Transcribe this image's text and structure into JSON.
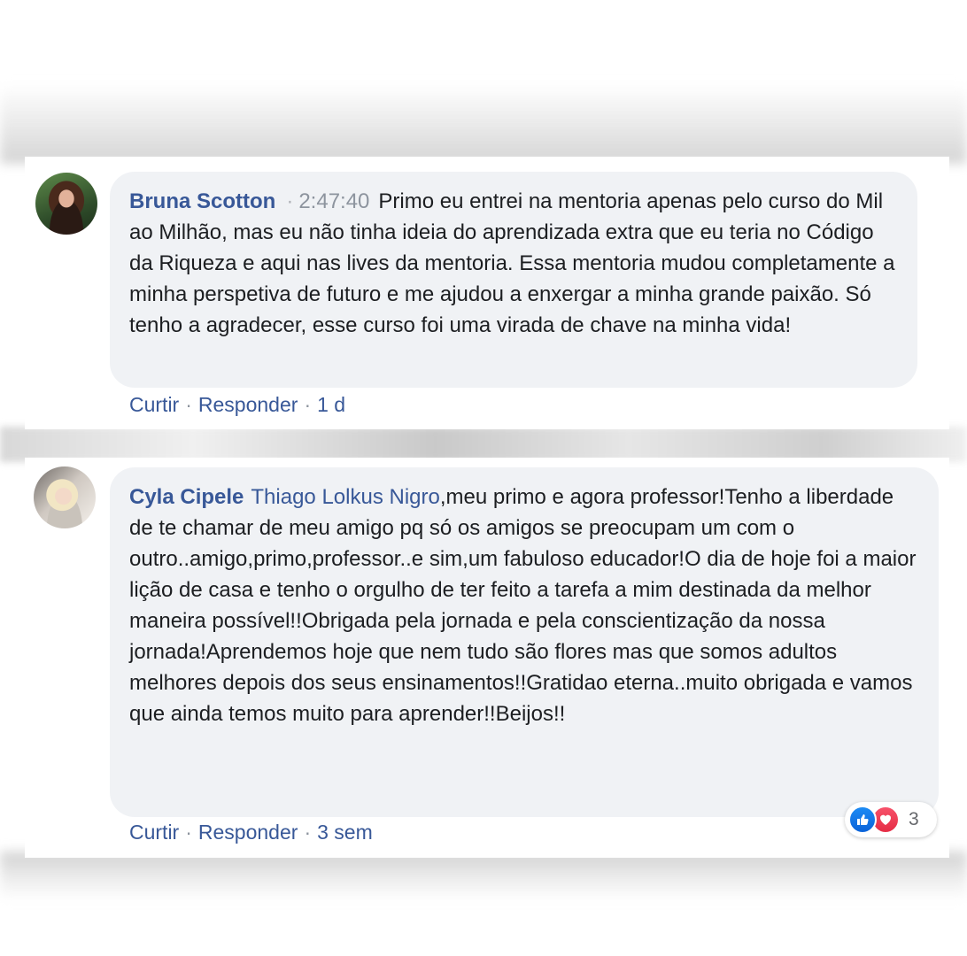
{
  "comments": [
    {
      "author": "Bruna Scotton",
      "separator": "·",
      "timestamp": "2:47:40",
      "text": "Primo eu entrei na mentoria apenas pelo curso do Mil ao Milhão, mas eu não tinha ideia do aprendizada extra que eu teria no Código da Riqueza e aqui nas lives da mentoria. Essa mentoria mudou completamente a minha perspetiva de futuro e me ajudou a enxergar a minha grande paixão. Só tenho a agradecer, esse curso foi uma virada de chave na minha vida!",
      "actions": {
        "like": "Curtir",
        "reply": "Responder",
        "dot": "·",
        "age": "1 d"
      }
    },
    {
      "author": "Cyla Cipele",
      "mention": "Thiago Lolkus Nigro",
      "text": ",meu primo e agora professor!Tenho a liberdade de te chamar de meu amigo pq só os amigos se preocupam um com o outro..amigo,primo,professor..e sim,um fabuloso educador!O dia de hoje foi a maior lição de casa e tenho o orgulho de ter feito a tarefa a mim destinada da melhor maneira possível!!Obrigada pela jornada e pela conscientização da nossa jornada!Aprendemos hoje que nem tudo são flores mas que somos adultos melhores depois dos seus ensinamentos!!Gratidao eterna..muito obrigada e vamos que ainda temos muito para aprender!!Beijos!!",
      "actions": {
        "like": "Curtir",
        "reply": "Responder",
        "dot": "·",
        "age": "3 sem"
      },
      "reactions": {
        "icons": [
          "like-icon",
          "love-icon"
        ],
        "count": "3",
        "like_color": "#1877f2",
        "love_color": "#f33e58"
      }
    }
  ],
  "colors": {
    "author": "#385898",
    "bubble": "#f0f2f5",
    "text": "#1c1e21",
    "muted": "#65676b"
  }
}
